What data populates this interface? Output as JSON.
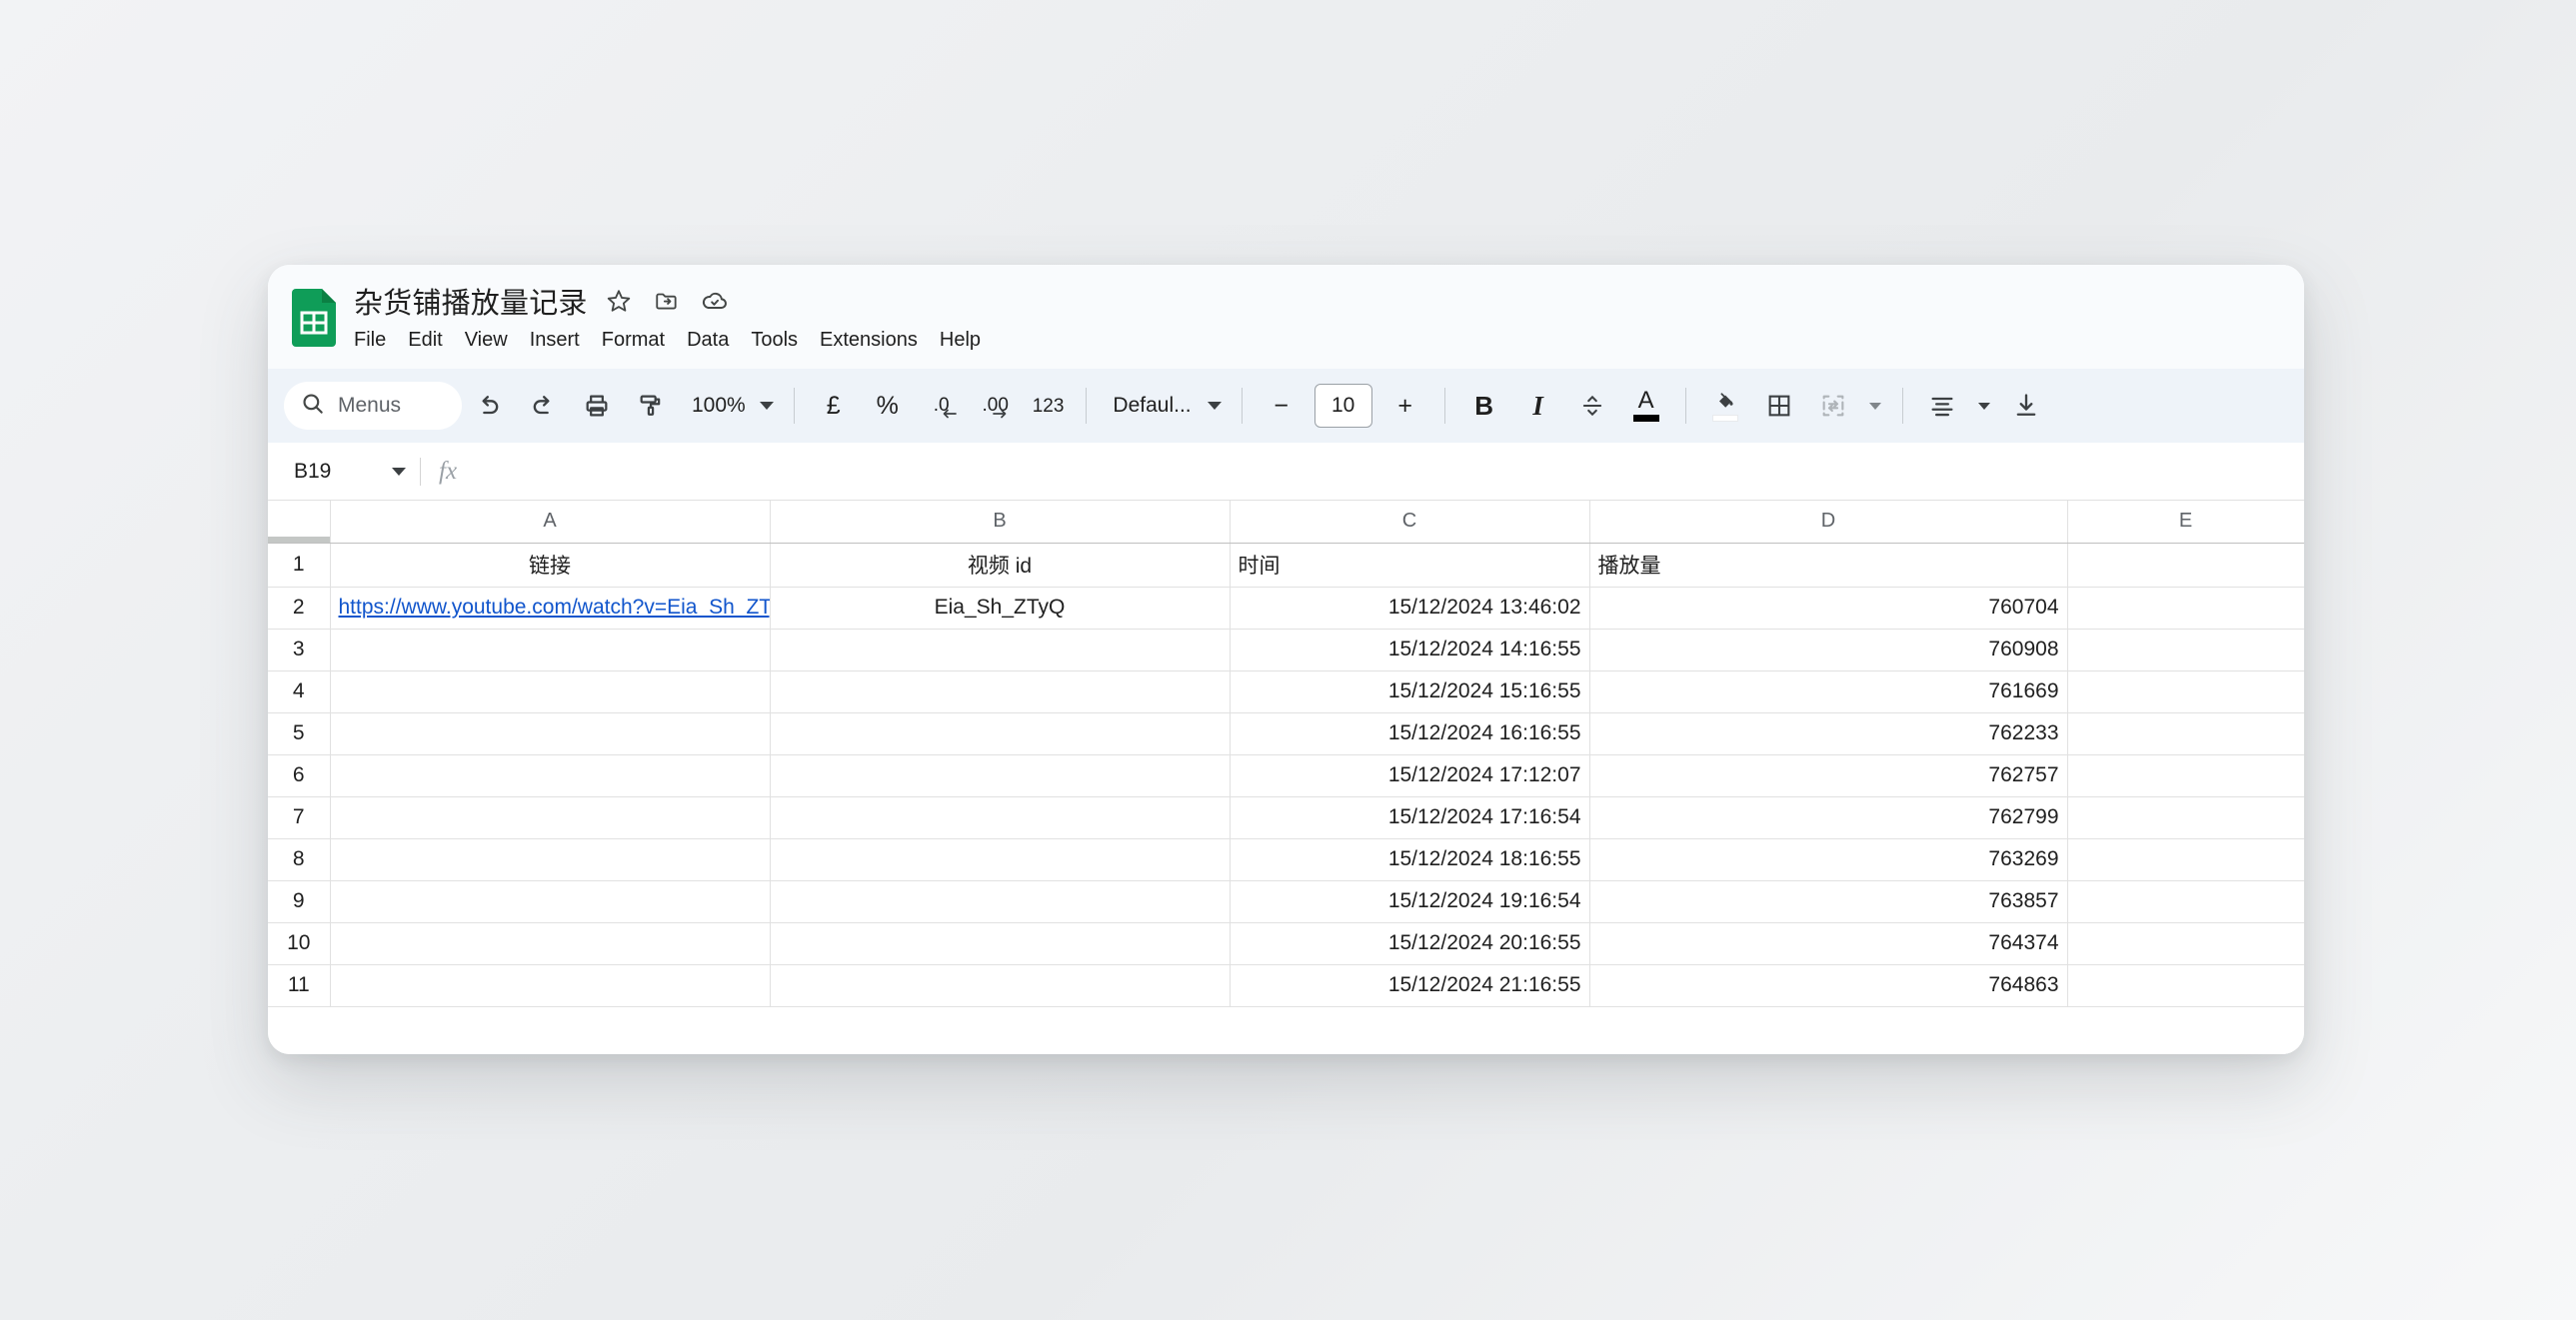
{
  "window": {
    "title": "杂货铺播放量记录",
    "app_icon": "google-sheets-icon",
    "title_icons": [
      "star-icon",
      "move-to-folder-icon",
      "cloud-saved-icon"
    ]
  },
  "menubar": {
    "items": [
      "File",
      "Edit",
      "View",
      "Insert",
      "Format",
      "Data",
      "Tools",
      "Extensions",
      "Help"
    ]
  },
  "toolbar": {
    "search_label": "Menus",
    "search_icon": "search-icon",
    "undo_icon": "undo-icon",
    "redo_icon": "redo-icon",
    "print_icon": "print-icon",
    "paint_format_icon": "paint-format-icon",
    "zoom_value": "100%",
    "currency_glyph": "£",
    "percent_glyph": "%",
    "decrease_decimal_glyph": ".0",
    "increase_decimal_glyph": ".00",
    "number_format_glyph": "123",
    "font_family_value": "Defaul...",
    "font_size_decrease": "−",
    "font_size_value": "10",
    "font_size_increase": "+",
    "bold_glyph": "B",
    "italic_glyph": "I",
    "strikethrough_icon": "strikethrough-icon",
    "text_color_glyph": "A",
    "fill_color_icon": "fill-color-icon",
    "borders_icon": "borders-icon",
    "merge_cells_icon": "merge-cells-icon",
    "horizontal_align_icon": "horizontal-align-icon",
    "vertical_align_icon": "vertical-align-icon"
  },
  "formula_bar": {
    "name_box_value": "B19",
    "fx_glyph": "fx",
    "formula_value": ""
  },
  "grid": {
    "selected_column": "B",
    "columns": [
      "A",
      "B",
      "C",
      "D",
      "E"
    ],
    "row_numbers": [
      "1",
      "2",
      "3",
      "4",
      "5",
      "6",
      "7",
      "8",
      "9",
      "10",
      "11"
    ],
    "rows": [
      {
        "a": "链接",
        "b": "视频 id",
        "c": "时间",
        "d": "播放量",
        "e": ""
      },
      {
        "a": "https://www.youtube.com/watch?v=Eia_Sh_ZTyQ",
        "a_is_link": true,
        "b": "Eia_Sh_ZTyQ",
        "c": "15/12/2024 13:46:02",
        "d": "760704",
        "e": ""
      },
      {
        "a": "",
        "b": "",
        "c": "15/12/2024 14:16:55",
        "d": "760908",
        "e": ""
      },
      {
        "a": "",
        "b": "",
        "c": "15/12/2024 15:16:55",
        "d": "761669",
        "e": ""
      },
      {
        "a": "",
        "b": "",
        "c": "15/12/2024 16:16:55",
        "d": "762233",
        "e": ""
      },
      {
        "a": "",
        "b": "",
        "c": "15/12/2024 17:12:07",
        "d": "762757",
        "e": ""
      },
      {
        "a": "",
        "b": "",
        "c": "15/12/2024 17:16:54",
        "d": "762799",
        "e": ""
      },
      {
        "a": "",
        "b": "",
        "c": "15/12/2024 18:16:55",
        "d": "763269",
        "e": ""
      },
      {
        "a": "",
        "b": "",
        "c": "15/12/2024 19:16:54",
        "d": "763857",
        "e": ""
      },
      {
        "a": "",
        "b": "",
        "c": "15/12/2024 20:16:55",
        "d": "764374",
        "e": ""
      },
      {
        "a": "",
        "b": "",
        "c": "15/12/2024 21:16:55",
        "d": "764863",
        "e": ""
      }
    ]
  },
  "colors": {
    "sheets_green": "#0f9d58",
    "selected_header_bg": "#d3e3fd",
    "selected_header_text": "#0b57d0",
    "link_blue": "#1155cc",
    "toolbar_bg": "#eef3f9",
    "header_bg": "#f9fbfd"
  }
}
